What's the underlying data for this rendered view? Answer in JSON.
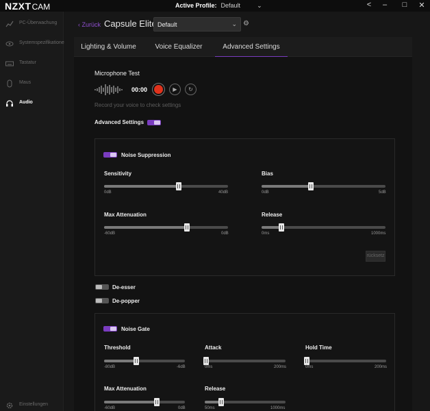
{
  "titlebar": {
    "brand": "NZXT",
    "product": "CAM",
    "profile_label": "Active Profile:",
    "profile_value": "Default",
    "profile_chevron": "⌄",
    "btn_back": "<",
    "btn_min": "–",
    "btn_max": "□",
    "btn_close": "✕"
  },
  "sidebar": {
    "items": [
      {
        "label": "PC-Überwachung",
        "icon": "chart-icon"
      },
      {
        "label": "Systemspezifikationen",
        "icon": "eye-icon"
      },
      {
        "label": "Tastatur",
        "icon": "keyboard-icon"
      },
      {
        "label": "Maus",
        "icon": "mouse-icon"
      },
      {
        "label": "Audio",
        "icon": "headset-icon"
      }
    ],
    "settings": {
      "label": "Einstellungen",
      "icon": "gear-icon"
    }
  },
  "header": {
    "back_label": "Zurück",
    "device_name": "Capsule Elite",
    "preset_value": "Default"
  },
  "tabs": [
    "Lighting & Volume",
    "Voice Equalizer",
    "Advanced Settings"
  ],
  "mic_test": {
    "title": "Microphone Test",
    "time": "00:00",
    "hint": "Record your voice to check settings"
  },
  "advanced": {
    "label": "Advanced Settings",
    "enabled": true
  },
  "noise_suppression": {
    "label": "Noise Suppression",
    "enabled": true,
    "sliders": [
      {
        "label": "Sensitivity",
        "min": "0dB",
        "max": "40dB",
        "value": 0.6
      },
      {
        "label": "Bias",
        "min": "0dB",
        "max": "5dB",
        "value": 0.4
      },
      {
        "label": "Max Attenuation",
        "min": "-60dB",
        "max": "0dB",
        "value": 0.67
      },
      {
        "label": "Release",
        "min": "0ms",
        "max": "1000ms",
        "value": 0.16
      }
    ],
    "reset_label": "rücksetz"
  },
  "de_esser": {
    "label": "De-esser",
    "enabled": false
  },
  "de_popper": {
    "label": "De-popper",
    "enabled": false
  },
  "noise_gate": {
    "label": "Noise Gate",
    "enabled": true,
    "sliders": [
      {
        "label": "Threshold",
        "min": "-80dB",
        "max": "-6dB",
        "value": 0.4
      },
      {
        "label": "Attack",
        "min": "0ms",
        "max": "200ms",
        "value": 0.02
      },
      {
        "label": "Hold Time",
        "min": "0ms",
        "max": "200ms",
        "value": 0.02
      },
      {
        "label": "Max Attenuation",
        "min": "-60dB",
        "max": "0dB",
        "value": 0.65
      },
      {
        "label": "Release",
        "min": "50ms",
        "max": "1000ms",
        "value": 0.2
      }
    ]
  },
  "colors": {
    "accent": "#7a3cc0",
    "record": "#e0321c",
    "back_link": "#8f4fd0"
  }
}
